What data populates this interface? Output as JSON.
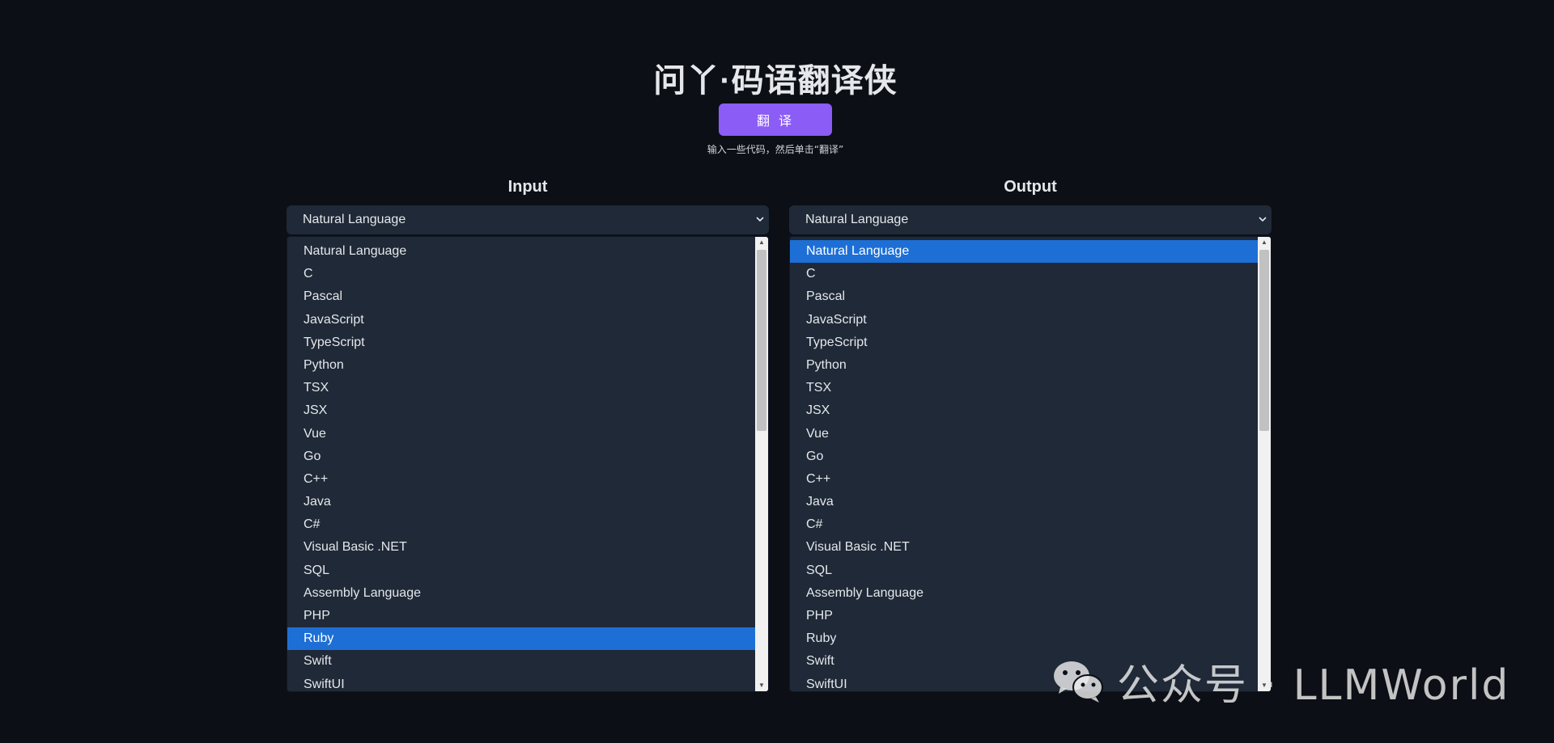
{
  "header": {
    "title": "问丫·码语翻译侠",
    "translate_button": "翻 译",
    "hint": "输入一些代码，然后单击“翻译”"
  },
  "input_panel": {
    "label": "Input",
    "selected_value": "Natural Language",
    "options": [
      "Natural Language",
      "C",
      "Pascal",
      "JavaScript",
      "TypeScript",
      "Python",
      "TSX",
      "JSX",
      "Vue",
      "Go",
      "C++",
      "Java",
      "C#",
      "Visual Basic .NET",
      "SQL",
      "Assembly Language",
      "PHP",
      "Ruby",
      "Swift",
      "SwiftUI"
    ],
    "highlighted_option": "Ruby"
  },
  "output_panel": {
    "label": "Output",
    "selected_value": "Natural Language",
    "options": [
      "Natural Language",
      "C",
      "Pascal",
      "JavaScript",
      "TypeScript",
      "Python",
      "TSX",
      "JSX",
      "Vue",
      "Go",
      "C++",
      "Java",
      "C#",
      "Visual Basic .NET",
      "SQL",
      "Assembly Language",
      "PHP",
      "Ruby",
      "Swift",
      "SwiftUI"
    ],
    "highlighted_option": "Natural Language"
  },
  "watermark": {
    "text": "公众号 · LLMWorld"
  },
  "icons": {
    "dropdown": "chevron-down-icon",
    "scroll_up": "scroll-up-arrow-icon",
    "scroll_down": "scroll-down-arrow-icon",
    "watermark_logo": "wechat-icon"
  },
  "colors": {
    "background": "#0c0f15",
    "panel": "#1f2937",
    "accent_button": "#8b5cf6",
    "selection": "#1d6fd6"
  }
}
